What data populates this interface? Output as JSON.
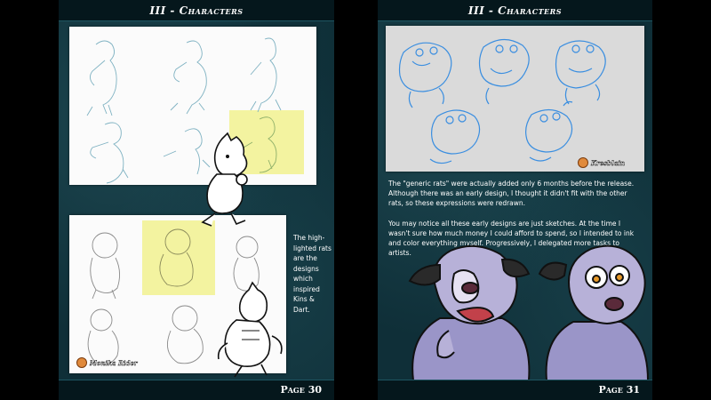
{
  "left_page": {
    "header": "III - Characters",
    "footer": "Page 30",
    "side_note": "The high-lighted rats are the designs which inspired Kins & Dart.",
    "credit": "Monika Rider",
    "credit_icon": "artist-logo-icon"
  },
  "right_page": {
    "header": "III - Characters",
    "footer": "Page 31",
    "credit": "Kresblain",
    "credit_icon": "artist-logo-icon",
    "paragraph_1": "The \"generic rats\" were actually added only 6 months before the release. Although there was an early design, I thought it didn't fit with the other rats, so these expressions were redrawn.",
    "paragraph_2": "You may notice all these early designs are just sketches. At the time I wasn't sure how much money I could afford to spend, so I intended to ink and color everything myself. Progressively, I delegated more tasks to artists."
  },
  "colors": {
    "background": "#0f2f38",
    "bar": "#05171c",
    "highlight": "#f3f3a0",
    "blue_sketch": "#3a8ee0",
    "rat_body": "#9a95c8",
    "rat_fur": "#b7b1d8"
  }
}
